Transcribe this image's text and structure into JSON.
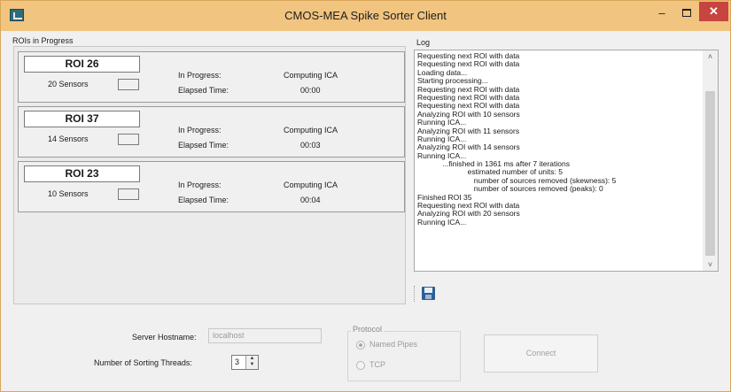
{
  "window": {
    "title": "CMOS-MEA Spike Sorter Client",
    "minimize": "–",
    "close": "✕"
  },
  "rois": {
    "group_label": "ROIs in Progress",
    "in_progress_label": "In Progress:",
    "elapsed_label": "Elapsed Time:",
    "items": [
      {
        "name": "ROI 26",
        "sensors": "20 Sensors",
        "status": "Computing ICA",
        "elapsed": "00:00"
      },
      {
        "name": "ROI 37",
        "sensors": "14 Sensors",
        "status": "Computing ICA",
        "elapsed": "00:03"
      },
      {
        "name": "ROI 23",
        "sensors": "10 Sensors",
        "status": "Computing ICA",
        "elapsed": "00:04"
      }
    ]
  },
  "log": {
    "label": "Log",
    "lines": [
      "Requesting next ROI with data",
      "Requesting next ROI with data",
      "Loading data...",
      "Starting processing...",
      "Requesting next ROI with data",
      "Requesting next ROI with data",
      "Requesting next ROI with data",
      "Analyzing ROI with 10 sensors",
      "Running ICA...",
      "Analyzing ROI with 11 sensors",
      "Running ICA...",
      "Analyzing ROI with 14 sensors",
      "Running ICA...",
      "            ...finished in 1361 ms after 7 iterations",
      "                        estimated number of units: 5",
      "                           number of sources removed (skewness): 5",
      "                           number of sources removed (peaks): 0",
      "Finished ROI 35",
      "Requesting next ROI with data",
      "Analyzing ROI with 20 sensors",
      "Running ICA..."
    ],
    "scroll_up": "˄",
    "scroll_down": "˅"
  },
  "settings": {
    "hostname_label": "Server Hostname:",
    "hostname_value": "localhost",
    "threads_label": "Number of Sorting Threads:",
    "threads_value": "3",
    "protocol_label": "Protocol",
    "protocol_options": [
      "Named Pipes",
      "TCP"
    ],
    "protocol_selected": "Named Pipes",
    "connect_label": "Connect"
  },
  "icons": {
    "app": "app-icon",
    "save": "floppy-disk-icon"
  },
  "colors": {
    "titlebar": "#f1c47f",
    "close_button": "#c7443f"
  }
}
